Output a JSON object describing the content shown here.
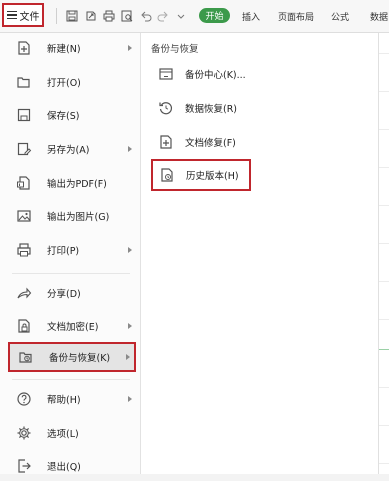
{
  "toolbar": {
    "file_label": "文件",
    "start_tab": "开始",
    "tabs": [
      "插入",
      "页面布局",
      "公式",
      "数据"
    ]
  },
  "menu": {
    "items": [
      {
        "label": "新建(N)",
        "icon": "new-icon"
      },
      {
        "label": "打开(O)",
        "icon": "folder-open-icon"
      },
      {
        "label": "保存(S)",
        "icon": "save-icon"
      },
      {
        "label": "另存为(A)",
        "icon": "save-as-icon"
      },
      {
        "label": "输出为PDF(F)",
        "icon": "pdf-export-icon"
      },
      {
        "label": "输出为图片(G)",
        "icon": "image-export-icon"
      },
      {
        "label": "打印(P)",
        "icon": "print-icon"
      },
      {
        "label": "分享(D)",
        "icon": "share-icon"
      },
      {
        "label": "文档加密(E)",
        "icon": "lock-icon"
      },
      {
        "label": "备份与恢复(K)",
        "icon": "backup-icon"
      },
      {
        "label": "帮助(H)",
        "icon": "help-icon"
      },
      {
        "label": "选项(L)",
        "icon": "gear-icon"
      },
      {
        "label": "退出(Q)",
        "icon": "exit-icon"
      }
    ]
  },
  "submenu": {
    "title": "备份与恢复",
    "items": [
      {
        "label": "备份中心(K)...",
        "icon": "backup-center-icon"
      },
      {
        "label": "数据恢复(R)",
        "icon": "data-recovery-icon"
      },
      {
        "label": "文档修复(F)",
        "icon": "doc-repair-icon"
      },
      {
        "label": "历史版本(H)",
        "icon": "history-version-icon"
      }
    ]
  },
  "colors": {
    "highlight_border": "#c0262d",
    "start_tab_bg": "#3c9a4b",
    "active_item_bg": "#e4e4e4"
  }
}
